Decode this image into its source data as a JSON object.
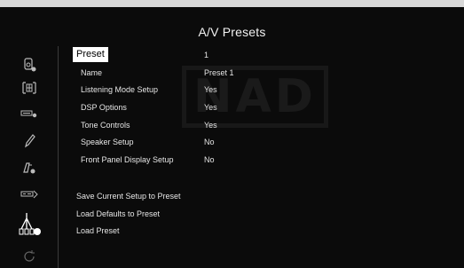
{
  "header": {
    "title": "A/V Presets"
  },
  "sidebar": {
    "items": [
      {
        "icon": "speaker-settings-icon"
      },
      {
        "icon": "audio-grid-icon"
      },
      {
        "icon": "input-device-icon"
      },
      {
        "icon": "tone-pen-icon"
      },
      {
        "icon": "speaker-config-icon"
      },
      {
        "icon": "display-device-icon"
      },
      {
        "icon": "av-presets-cables-icon"
      },
      {
        "icon": "refresh-icon"
      }
    ]
  },
  "preset": {
    "label": "Preset",
    "value": "1"
  },
  "settings": [
    {
      "label": "Name",
      "value": "Preset 1"
    },
    {
      "label": "Listening Mode Setup",
      "value": "Yes"
    },
    {
      "label": "DSP Options",
      "value": "Yes"
    },
    {
      "label": "Tone Controls",
      "value": "Yes"
    },
    {
      "label": "Speaker Setup",
      "value": "No"
    },
    {
      "label": "Front Panel Display Setup",
      "value": "No"
    }
  ],
  "actions": [
    {
      "label": "Save Current Setup to Preset"
    },
    {
      "label": "Load Defaults to Preset"
    },
    {
      "label": "Load Preset"
    }
  ],
  "watermark": "NAD",
  "colors": {
    "background": "#0b0b0b",
    "highlight": "#ffffff",
    "text": "#e6e6e6"
  }
}
